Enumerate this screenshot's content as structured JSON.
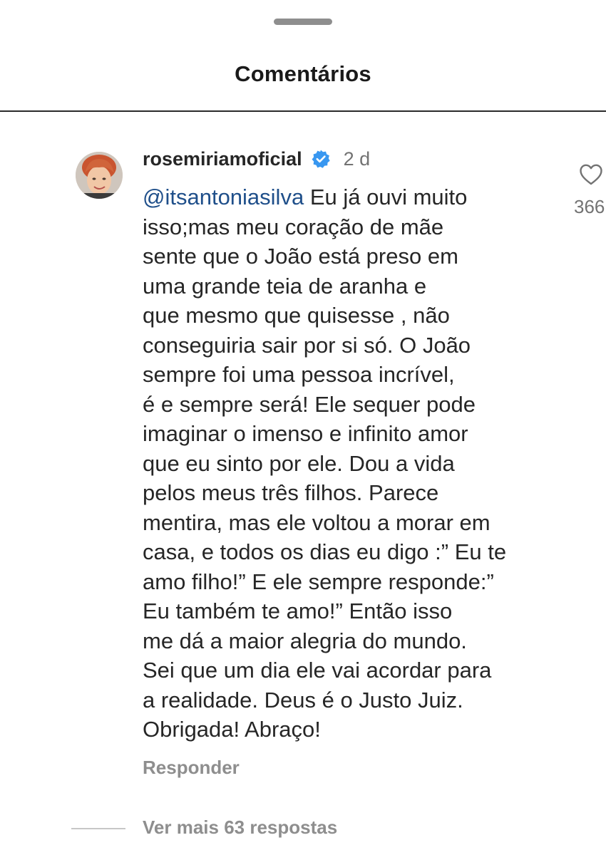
{
  "sheet": {
    "title": "Comentários"
  },
  "comment": {
    "username": "rosemiriamoficial",
    "verified_icon": "verified-badge-icon",
    "verified_color": "#3897f0",
    "timestamp": "2 d",
    "mention": "@itsantoniasilva",
    "body_lines": [
      " Eu já ouvi muito",
      "isso;mas meu coração de mãe",
      "sente que o João está preso em",
      "uma grande teia de aranha e",
      "que mesmo que quisesse , não",
      "conseguiria sair por si só. O João",
      "sempre foi uma pessoa incrível,",
      "é e sempre será! Ele sequer pode",
      "imaginar o imenso e infinito amor",
      "que eu sinto por ele. Dou a vida",
      "pelos meus três filhos. Parece",
      "mentira, mas ele voltou a morar em",
      "casa, e todos os dias eu digo :” Eu te",
      "amo filho!” E ele sempre responde:”",
      "Eu também te amo!” Então isso",
      "me dá a maior alegria do mundo.",
      "Sei que um dia ele vai acordar para",
      "a realidade. Deus é o Justo Juiz.",
      "Obrigada! Abraço!"
    ],
    "reply_label": "Responder",
    "like_icon": "heart-outline-icon",
    "like_count": "366",
    "view_more_replies": "Ver mais 63 respostas"
  },
  "colors": {
    "mention": "#1f4f8a",
    "secondary_text": "#8e8e8e",
    "primary_text": "#262626"
  }
}
